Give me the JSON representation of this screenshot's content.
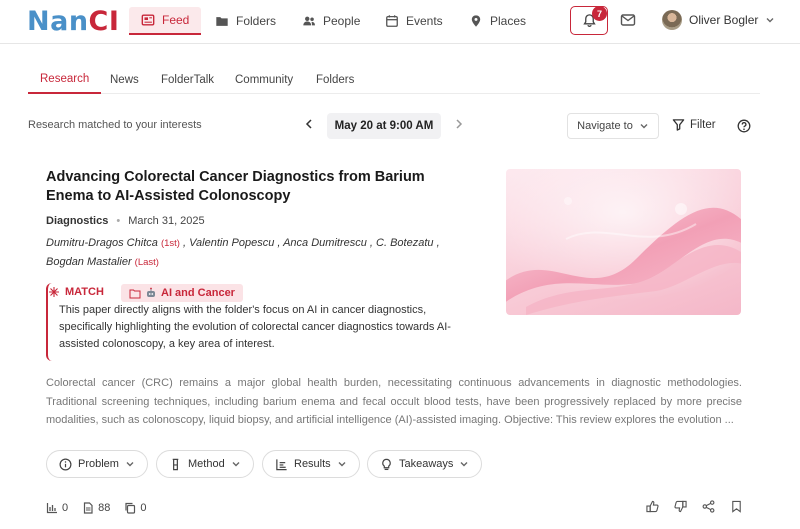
{
  "app": {
    "logo_a": "Nan",
    "logo_b": "CI"
  },
  "nav": [
    {
      "label": "Feed",
      "icon": "newspaper-icon"
    },
    {
      "label": "Folders",
      "icon": "folder-icon"
    },
    {
      "label": "People",
      "icon": "people-icon"
    },
    {
      "label": "Events",
      "icon": "calendar-icon"
    },
    {
      "label": "Places",
      "icon": "location-pin-icon"
    }
  ],
  "notifications": {
    "count": "7"
  },
  "user": {
    "name": "Oliver Bogler"
  },
  "subtabs": [
    "Research",
    "News",
    "FolderTalk",
    "Community",
    "Folders"
  ],
  "filters": {
    "matched_text": "Research matched to your interests",
    "date": "May 20 at 9:00 AM",
    "navigate": "Navigate to",
    "filter": "Filter"
  },
  "article": {
    "title": "Advancing Colorectal Cancer Diagnostics from Barium Enema to AI-Assisted Colonoscopy",
    "category": "Diagnostics",
    "date": "March 31, 2025",
    "authors": [
      {
        "name": "Dumitru-Dragos Chitca",
        "tag": "(1st)"
      },
      {
        "name": "Valentin Popescu",
        "tag": ""
      },
      {
        "name": "Anca Dumitrescu",
        "tag": ""
      },
      {
        "name": "C. Botezatu",
        "tag": ""
      },
      {
        "name": "Bogdan Mastalier",
        "tag": "(Last)"
      }
    ],
    "match_label": "MATCH",
    "match_folder": "AI and Cancer",
    "match_text": "This paper directly aligns with the folder's focus on AI in cancer diagnostics, specifically highlighting the evolution of colorectal cancer diagnostics towards AI-assisted colonoscopy, a key area of interest.",
    "abstract": "Colorectal cancer (CRC) remains a major global health burden, necessitating continuous advancements in diagnostic methodologies. Traditional screening techniques, including barium enema and fecal occult blood tests, have been progressively replaced by more precise modalities, such as colonoscopy, liquid biopsy, and artificial intelligence (AI)-assisted imaging. Objective: This review explores the evolution ..."
  },
  "sections": [
    {
      "label": "Problem",
      "icon": "info-circle-icon"
    },
    {
      "label": "Method",
      "icon": "flask-icon"
    },
    {
      "label": "Results",
      "icon": "bar-chart-icon"
    },
    {
      "label": "Takeaways",
      "icon": "lightbulb-icon"
    }
  ],
  "stats": {
    "views": "0",
    "citations": "88",
    "copies": "0"
  },
  "colors": {
    "accent": "#c8273a",
    "logo_blue": "#4a90c8"
  }
}
